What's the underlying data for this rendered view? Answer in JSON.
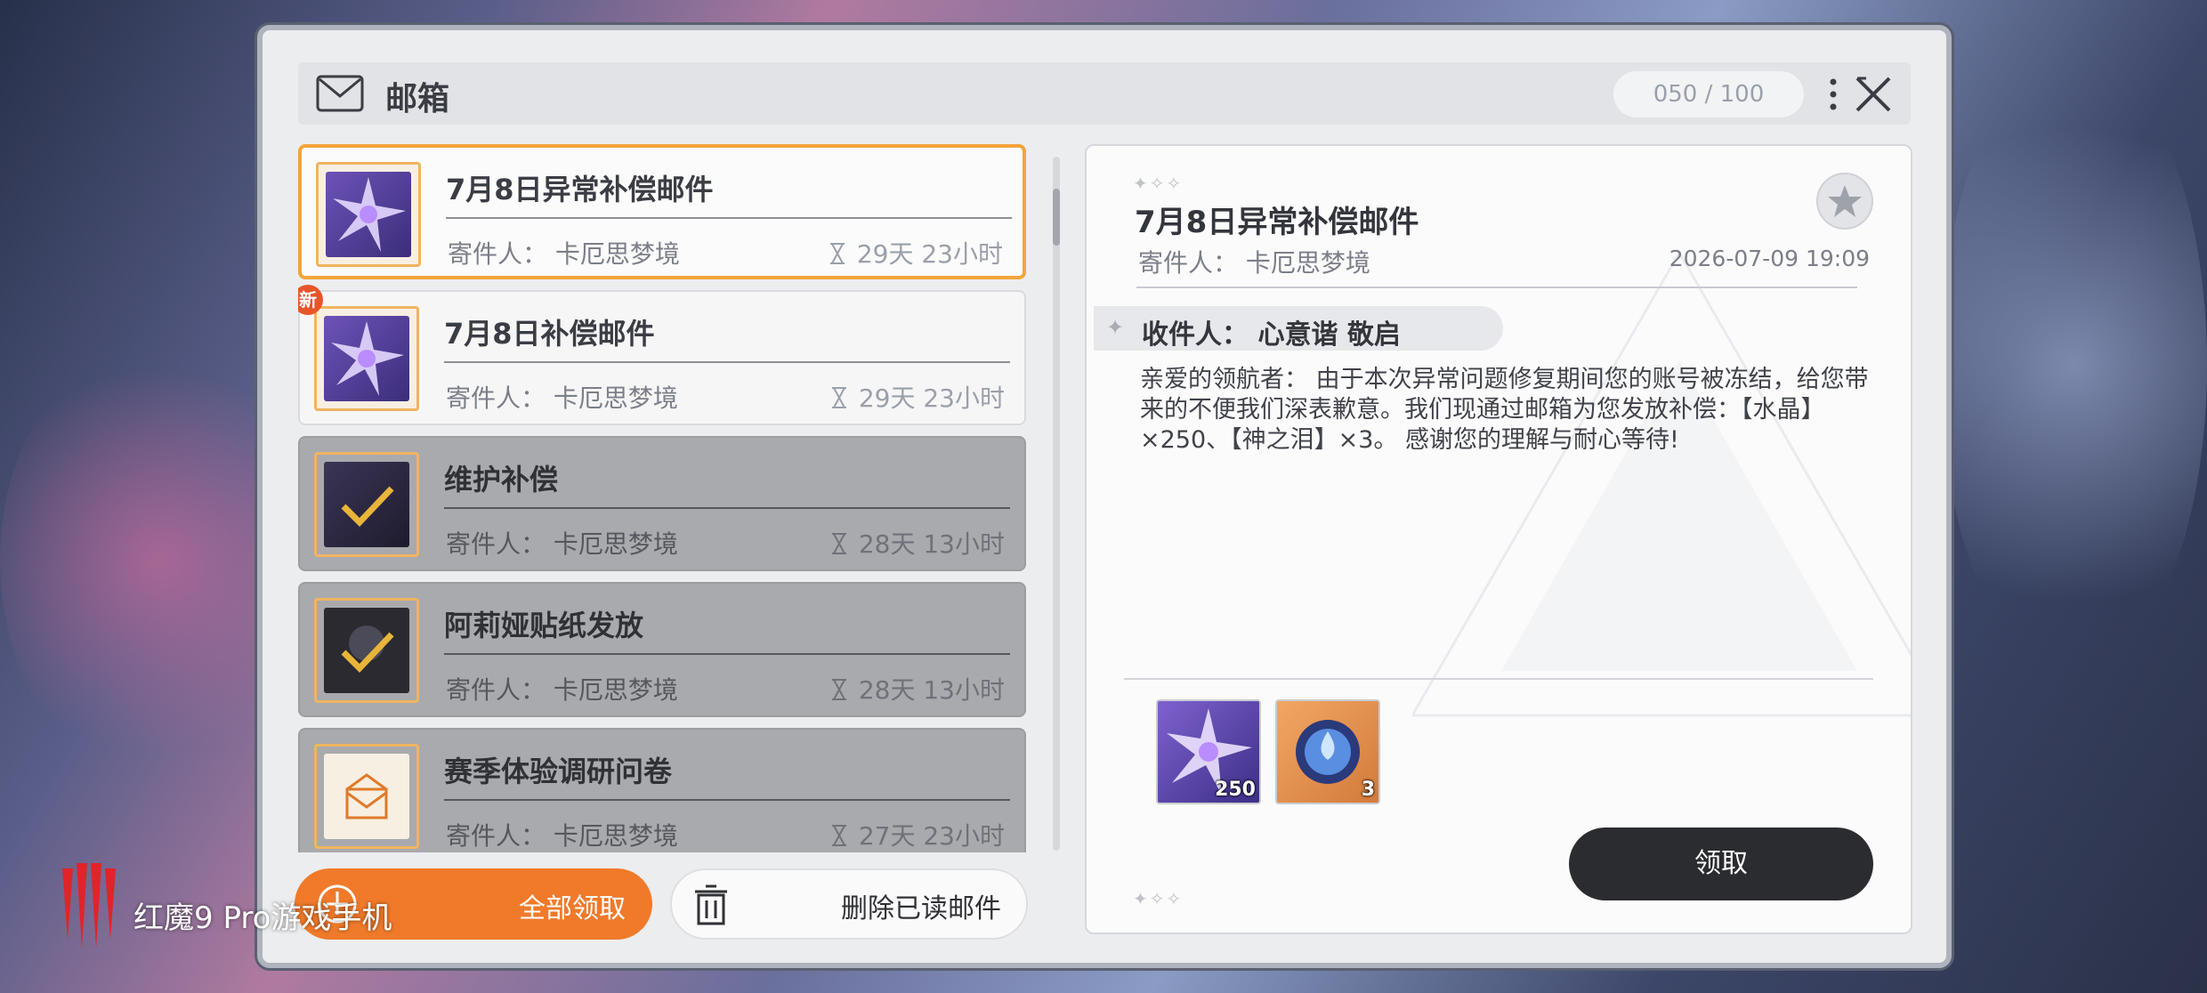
{
  "header": {
    "title": "邮箱",
    "count": "050 / 100"
  },
  "mails": [
    {
      "title": "7月8日异常补偿邮件",
      "sender": "寄件人： 卡厄思梦境",
      "time": "29天 23小时",
      "state": "selected",
      "new": false,
      "icon": "crystal-icon"
    },
    {
      "title": "7月8日补偿邮件",
      "sender": "寄件人： 卡厄思梦境",
      "time": "29天 23小时",
      "state": "unread",
      "new": true,
      "new_label": "新",
      "icon": "crystal-icon"
    },
    {
      "title": "维护补偿",
      "sender": "寄件人： 卡厄思梦境",
      "time": "28天 13小时",
      "state": "read",
      "new": false,
      "icon": "claimed-check-icon"
    },
    {
      "title": "阿莉娅贴纸发放",
      "sender": "寄件人： 卡厄思梦境",
      "time": "28天 13小时",
      "state": "read",
      "new": false,
      "icon": "claimed-check-icon"
    },
    {
      "title": "赛季体验调研问卷",
      "sender": "寄件人： 卡厄思梦境",
      "time": "27天 23小时",
      "state": "read",
      "new": false,
      "icon": "envelope-icon"
    }
  ],
  "buttons": {
    "claim_all": "全部领取",
    "delete_read": "删除已读邮件",
    "claim": "领取"
  },
  "detail": {
    "title": "7月8日异常补偿邮件",
    "sender": "寄件人： 卡厄思梦境",
    "date": "2026-07-09 19:09",
    "recipient": "收件人： 心意谐 敬启",
    "body": "亲爱的领航者： 由于本次异常问题修复期间您的账号被冻结，给您带来的不便我们深表歉意。我们现通过邮箱为您发放补偿：【水晶】×250、【神之泪】×3。 感谢您的理解与耐心等待!",
    "attachments": [
      {
        "icon": "crystal-icon",
        "qty": "250"
      },
      {
        "icon": "tear-orb-icon",
        "qty": "3"
      }
    ]
  },
  "watermark": {
    "text": "红魔9 Pro游戏手机"
  },
  "colors": {
    "accent_orange": "#f07a2a",
    "selected_border": "#f3a53a",
    "new_badge": "#e8552a",
    "dark_button": "#2b2c30"
  }
}
